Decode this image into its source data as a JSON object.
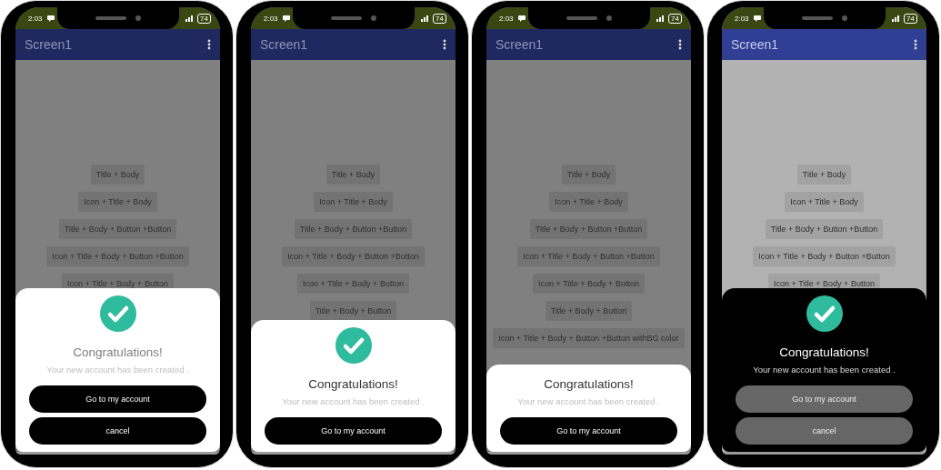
{
  "phones": [
    {
      "status_bar": {
        "time": "2:03",
        "battery": "74"
      },
      "app_bar": {
        "title": "Screen1"
      },
      "options": [
        "Title + Body",
        "Icon + Title + Body",
        "Title + Body + Button +Button",
        "Icon + Title + Body + Button +Button",
        "Icon + Title + Body + Button"
      ],
      "dialog": {
        "kind": "light",
        "show_icon": true,
        "title_muted": true,
        "title": "Congratulations!",
        "message": "Your new account has been created .",
        "buttons": [
          "Go to my account",
          "cancel"
        ]
      }
    },
    {
      "status_bar": {
        "time": "2:03",
        "battery": "74"
      },
      "app_bar": {
        "title": "Screen1"
      },
      "options": [
        "Title + Body",
        "Icon + Title + Body",
        "Title + Body + Button +Button",
        "Icon + Title + Body + Button +Button",
        "Icon + Title + Body + Button",
        "Title + Body + Button"
      ],
      "dialog": {
        "kind": "light",
        "show_icon": true,
        "title_muted": false,
        "title": "Congratulations!",
        "message": "Your new account has been created .",
        "buttons": [
          "Go to my account"
        ]
      }
    },
    {
      "status_bar": {
        "time": "2:03",
        "battery": "74"
      },
      "app_bar": {
        "title": "Screen1"
      },
      "options": [
        "Title + Body",
        "Icon + Title + Body",
        "Title + Body + Button +Button",
        "Icon + Title + Body + Button +Button",
        "Icon + Title + Body + Button",
        "Title + Body + Button",
        "Icon + Title + Body + Button +Button withBG color"
      ],
      "dialog": {
        "kind": "light",
        "show_icon": false,
        "title_muted": false,
        "title": "Congratulations!",
        "message": "Your new account has been created .",
        "buttons": [
          "Go to my account"
        ]
      }
    },
    {
      "status_bar": {
        "time": "2:03",
        "battery": "74"
      },
      "app_bar": {
        "title": "Screen1"
      },
      "options": [
        "Title + Body",
        "Icon + Title + Body",
        "Title + Body + Button +Button",
        "Icon + Title + Body + Button +Button",
        "Icon + Title + Body + Button"
      ],
      "dialog": {
        "kind": "dark",
        "show_icon": true,
        "title_muted": false,
        "title": "Congratulations!",
        "message": "Your new account has been created .",
        "buttons": [
          "Go to my account",
          "cancel"
        ]
      }
    }
  ]
}
